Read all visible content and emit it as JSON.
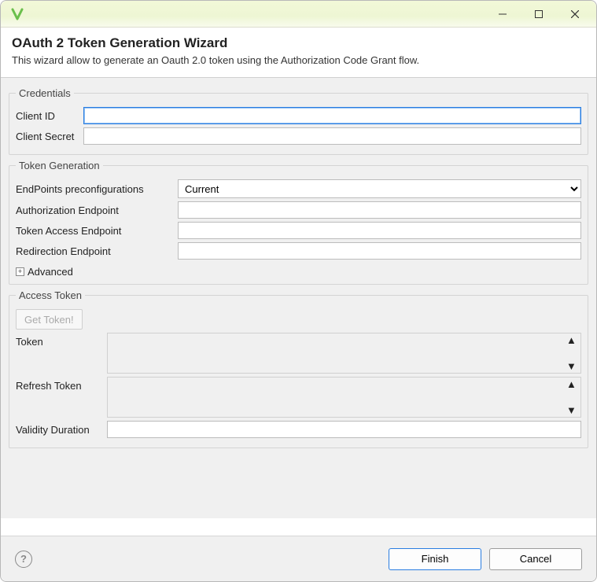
{
  "header": {
    "title": "OAuth 2 Token Generation Wizard",
    "description": "This wizard allow to generate an Oauth 2.0 token using the Authorization Code Grant flow."
  },
  "groups": {
    "credentials": {
      "legend": "Credentials",
      "client_id_label": "Client ID",
      "client_id_value": "",
      "client_secret_label": "Client Secret",
      "client_secret_value": ""
    },
    "token_generation": {
      "legend": "Token Generation",
      "endpoints_preconfig_label": "EndPoints preconfigurations",
      "endpoints_preconfig_value": "Current",
      "auth_endpoint_label": "Authorization Endpoint",
      "auth_endpoint_value": "",
      "token_endpoint_label": "Token Access Endpoint",
      "token_endpoint_value": "",
      "redirect_endpoint_label": "Redirection Endpoint",
      "redirect_endpoint_value": "",
      "advanced_label": "Advanced"
    },
    "access_token": {
      "legend": "Access Token",
      "get_token_button": "Get Token!",
      "token_label": "Token",
      "token_value": "",
      "refresh_token_label": "Refresh Token",
      "refresh_token_value": "",
      "validity_label": "Validity Duration",
      "validity_value": ""
    }
  },
  "buttons": {
    "finish": "Finish",
    "cancel": "Cancel"
  }
}
